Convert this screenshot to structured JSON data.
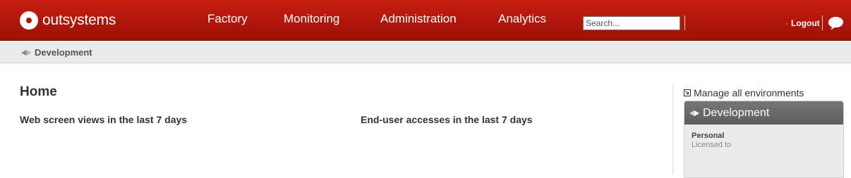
{
  "brand": {
    "name": "outsystems"
  },
  "nav": [
    {
      "label": "Factory"
    },
    {
      "label": "Monitoring"
    },
    {
      "label": "Administration"
    },
    {
      "label": "Analytics"
    }
  ],
  "search": {
    "placeholder": "Search..."
  },
  "user_menu": {
    "logout_label": "Logout"
  },
  "breadcrumb": {
    "label": "Development"
  },
  "page": {
    "title": "Home"
  },
  "widgets": {
    "web_views_title": "Web screen views in the last 7 days",
    "accesses_title": "End-user accesses in the last 7 days"
  },
  "sidebar": {
    "manage_link": "Manage all environments",
    "environment": {
      "name": "Development",
      "license_label": "Personal",
      "license_sub": "Licensed to"
    }
  },
  "colors": {
    "header_red": "#b3170c",
    "subbar_gray": "#ebebeb",
    "env_header_gray": "#666666"
  },
  "icons": [
    "outsystems-logo-icon",
    "chat-icon",
    "environment-icon",
    "external-link-icon"
  ]
}
